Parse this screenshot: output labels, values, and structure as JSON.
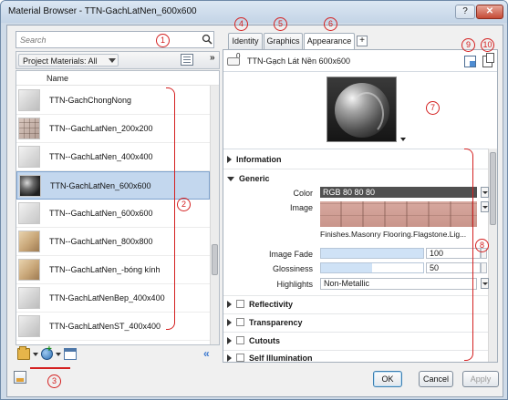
{
  "window": {
    "title": "Material Browser - TTN-GachLatNen_600x600",
    "help_label": "?",
    "close_label": "✕"
  },
  "search": {
    "placeholder": "Search"
  },
  "library": {
    "filter_label": "Project Materials: All",
    "column_name": "Name",
    "expand_label": "»"
  },
  "materials": [
    {
      "name": "TTN-GachChongNong",
      "thumb": "cube-grey",
      "selected": false
    },
    {
      "name": "TTN--GachLatNen_200x200",
      "thumb": "cube-tile",
      "selected": false
    },
    {
      "name": "TTN--GachLatNen_400x400",
      "thumb": "cube-grey2",
      "selected": false
    },
    {
      "name": "TTN-GachLatNen_600x600",
      "thumb": "sphere",
      "selected": true
    },
    {
      "name": "TTN--GachLatNen_600x600",
      "thumb": "cube-grey2",
      "selected": false
    },
    {
      "name": "TTN--GachLatNen_800x800",
      "thumb": "cube-tan",
      "selected": false
    },
    {
      "name": "TTN--GachLatNen_-bóng kính",
      "thumb": "cube-tan",
      "selected": false
    },
    {
      "name": "TTN-GachLatNenBep_400x400",
      "thumb": "cube-grey",
      "selected": false
    },
    {
      "name": "TTN-GachLatNenST_400x400",
      "thumb": "cube-grey",
      "selected": false
    }
  ],
  "bottom_toolbar": {
    "collapse_label": "«",
    "icons": [
      "folder-icon",
      "new-material-icon",
      "browser-icon"
    ]
  },
  "tabs": [
    {
      "label": "Identity",
      "active": false
    },
    {
      "label": "Graphics",
      "active": false
    },
    {
      "label": "Appearance",
      "active": true
    }
  ],
  "tab_add_label": "+",
  "asset": {
    "name": "TTN-Gạch Lát Nền 600x600",
    "usage_count": "0"
  },
  "properties": {
    "sections_top": [
      {
        "label": "Information",
        "expanded": false
      }
    ],
    "generic": {
      "label": "Generic",
      "color_label": "Color",
      "color_value": "RGB 80 80 80",
      "image_label": "Image",
      "image_name": "Finishes.Masonry Flooring.Flagstone.Lig...",
      "image_fade_label": "Image Fade",
      "image_fade_value": "100",
      "image_fade_level": 1.0,
      "glossiness_label": "Glossiness",
      "glossiness_value": "50",
      "glossiness_level": 0.5,
      "highlights_label": "Highlights",
      "highlights_value": "Non-Metallic"
    },
    "sections_bottom": [
      {
        "label": "Reflectivity",
        "checked": false
      },
      {
        "label": "Transparency",
        "checked": false
      },
      {
        "label": "Cutouts",
        "checked": false
      },
      {
        "label": "Self Illumination",
        "checked": false
      }
    ]
  },
  "buttons": {
    "ok": "OK",
    "cancel": "Cancel",
    "apply": "Apply"
  },
  "annotations": [
    "1",
    "2",
    "3",
    "4",
    "5",
    "6",
    "7",
    "8",
    "9",
    "10"
  ],
  "colors": {
    "annotation": "#d42020",
    "selection": "#c3d7ee",
    "color_swatch": "#505050"
  }
}
